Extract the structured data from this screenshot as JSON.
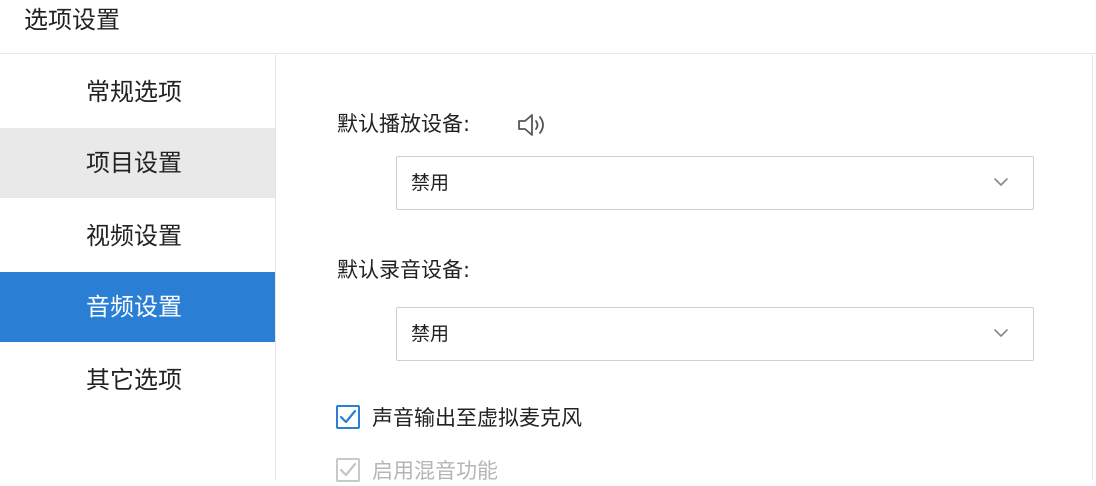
{
  "window": {
    "title": "选项设置"
  },
  "sidebar": {
    "items": [
      {
        "label": "常规选项"
      },
      {
        "label": "项目设置"
      },
      {
        "label": "视频设置"
      },
      {
        "label": "音频设置"
      },
      {
        "label": "其它选项"
      }
    ],
    "active_index": 3,
    "hover_index": 1
  },
  "audio": {
    "playback_label": "默认播放设备:",
    "playback_value": "禁用",
    "record_label": "默认录音设备:",
    "record_value": "禁用",
    "virtual_mic_label": "声音输出至虚拟麦克风",
    "virtual_mic_checked": true,
    "mix_label": "启用混音功能",
    "mix_checked": true,
    "mix_disabled": true
  },
  "colors": {
    "accent": "#2a7fd4",
    "hover": "#e9e9e9"
  }
}
